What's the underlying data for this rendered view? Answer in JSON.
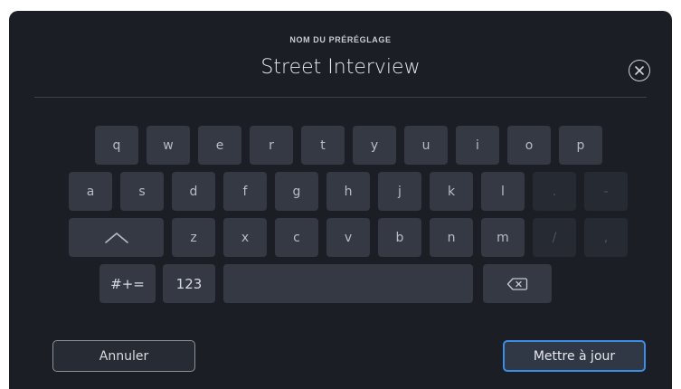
{
  "header": {
    "label": "NOM DU PRÉRÉGLAGE",
    "value": "Street Interview"
  },
  "keyboard": {
    "row1": [
      "q",
      "w",
      "e",
      "r",
      "t",
      "y",
      "u",
      "i",
      "o",
      "p"
    ],
    "row2": [
      "a",
      "s",
      "d",
      "f",
      "g",
      "h",
      "j",
      "k",
      "l",
      ".",
      "-"
    ],
    "row3": [
      "z",
      "x",
      "c",
      "v",
      "b",
      "n",
      "m",
      "/",
      ","
    ],
    "symbols_label": "#+=",
    "numbers_label": "123"
  },
  "buttons": {
    "cancel": "Annuler",
    "update": "Mettre à jour"
  },
  "colors": {
    "background": "#1b1e25",
    "key": "#353943",
    "key_disabled": "#262a32",
    "accent": "#3a8ee8"
  },
  "icons": {
    "close": "close-circle-icon",
    "shift": "shift-up-icon",
    "backspace": "backspace-icon"
  }
}
